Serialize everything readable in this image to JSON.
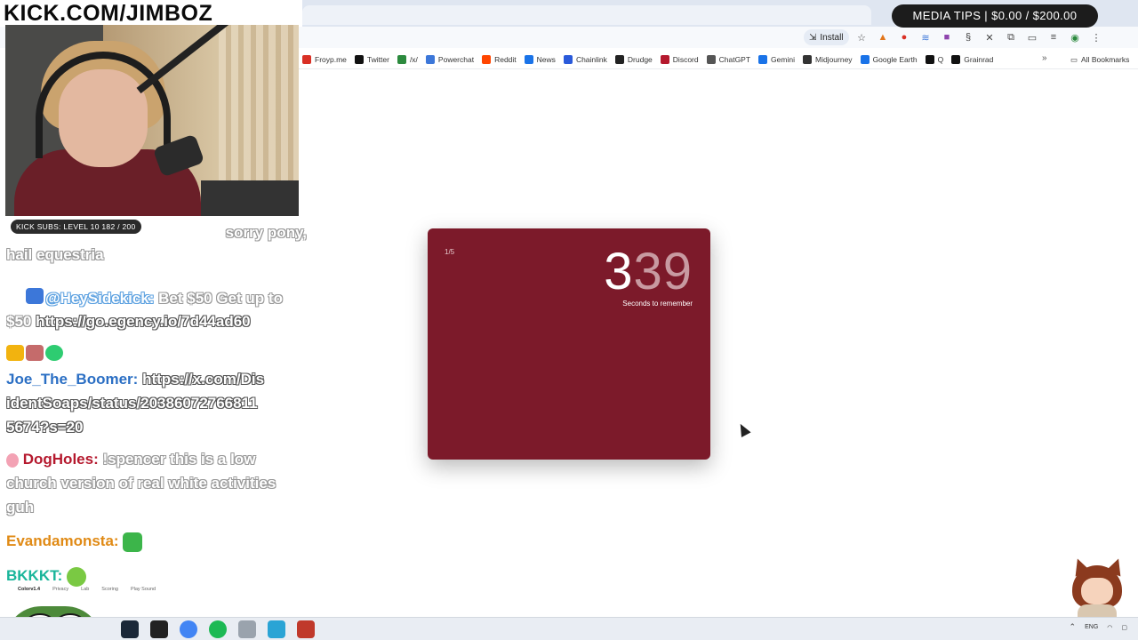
{
  "stream": {
    "header": "KICK.COM/JIMBOZ",
    "kick_subs": "KICK SUBS: LEVEL 10 182 / 200",
    "media_tips": "MEDIA TIPS | $0.00 / $200.00"
  },
  "browser": {
    "install_label": "Install",
    "bookmarks": [
      {
        "label": "Froyp.me",
        "color": "#d93025"
      },
      {
        "label": "Twitter",
        "color": "#111111"
      },
      {
        "label": "/x/",
        "color": "#2c8a3e"
      },
      {
        "label": "Powerchat",
        "color": "#3c77d9"
      },
      {
        "label": "Reddit",
        "color": "#ff4500"
      },
      {
        "label": "News",
        "color": "#1a73e8"
      },
      {
        "label": "Chainlink",
        "color": "#2a5ada"
      },
      {
        "label": "Drudge",
        "color": "#222222"
      },
      {
        "label": "Discord",
        "color": "#b5192e"
      },
      {
        "label": "ChatGPT",
        "color": "#555555"
      },
      {
        "label": "Gemini",
        "color": "#1a73e8"
      },
      {
        "label": "Midjourney",
        "color": "#333333"
      },
      {
        "label": "Google Earth",
        "color": "#1a73e8"
      },
      {
        "label": "Q",
        "color": "#111111"
      },
      {
        "label": "Grainrad",
        "color": "#111111"
      }
    ],
    "more_label": "»",
    "all_bookmarks_label": "All Bookmarks"
  },
  "game": {
    "level": "1/5",
    "number_shown": "3",
    "number_faded": "39",
    "caption": "Seconds to remember",
    "card_color": "#7c1a2a"
  },
  "chat": {
    "line1": "sorry pony,",
    "line2": "hail equestria",
    "msg2_user": "@HeySidekick:",
    "msg2_text_a": "Bet $50 Get up to",
    "msg2_text_b": "$50",
    "msg2_link": "https://go.egency.io/7d44ad60",
    "msg3_user": "Joe_The_Boomer:",
    "msg3_link_a": "https://x.com/Dis",
    "msg3_link_b": "identSoaps/status/20386072766811",
    "msg3_link_c": "5674?s=20",
    "msg4_user": "DogHoles:",
    "msg4_text_a": "!spencer this is a low",
    "msg4_text_b": "church version of real white activities",
    "msg4_text_c": "guh",
    "msg5_user": "Evandamonsta:",
    "msg6_user": "BKKKT:"
  },
  "mini_footer": {
    "brand": "Colorv1.4",
    "items": [
      "Privacy",
      "Lab",
      "Scoring",
      "Play Sound"
    ]
  },
  "tray": {
    "lang": "ENG"
  }
}
